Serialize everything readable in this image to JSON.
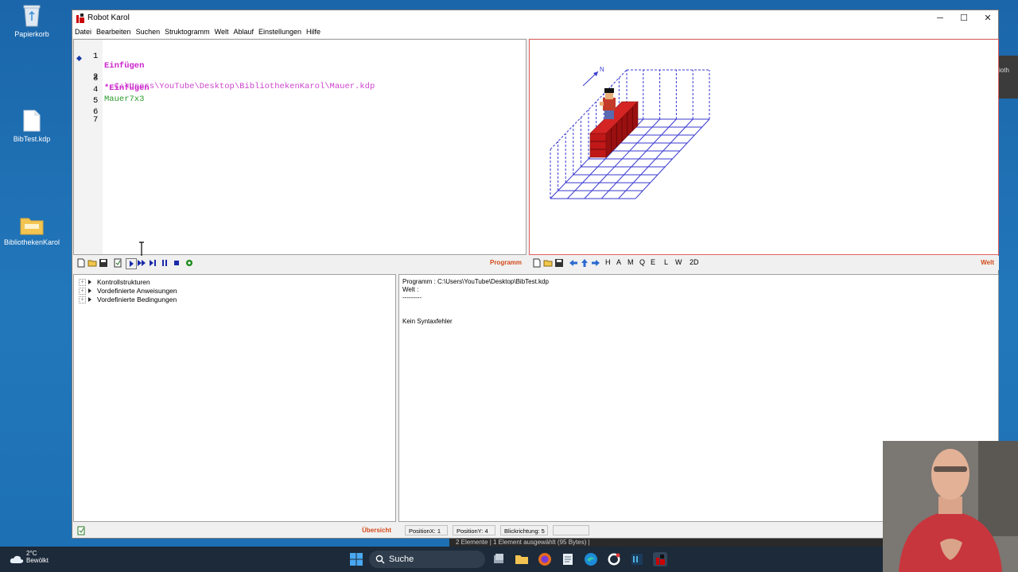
{
  "desktop": {
    "icons": [
      {
        "label": "Papierkorb"
      },
      {
        "label": "BibTest.kdp"
      },
      {
        "label": "BibliothekenKarol"
      }
    ],
    "right_edge_text": "ioth"
  },
  "window": {
    "title": "Robot Karol",
    "controls": {
      "minimize": "─",
      "maximize": "☐",
      "close": "✕"
    }
  },
  "menu": [
    "Datei",
    "Bearbeiten",
    "Suchen",
    "Struktogramm",
    "Welt",
    "Ablauf",
    "Einstellungen",
    "Hilfe"
  ],
  "editor": {
    "lines": [
      {
        "num": "1",
        "text": "Einfügen",
        "style": "kw"
      },
      {
        "num": "2",
        "text": "  C:\\Users\\YouTube\\Desktop\\BibliothekenKarol\\Mauer.kdp",
        "style": "path"
      },
      {
        "num": "3",
        "text": "*Einfügen",
        "style": "kw"
      },
      {
        "num": "4",
        "text": "Mauer7x3",
        "style": "ident"
      },
      {
        "num": "5",
        "text": "",
        "style": ""
      },
      {
        "num": "6",
        "text": "",
        "style": ""
      },
      {
        "num": "7",
        "text": "",
        "style": ""
      }
    ],
    "toolbar_title": "Programm"
  },
  "world": {
    "compass": "N",
    "toolbar_letters": [
      "H",
      "A",
      "M",
      "Q",
      "E",
      "L",
      "W",
      "2D"
    ],
    "toolbar_title": "Welt"
  },
  "tree": {
    "items": [
      "Kontrollstrukturen",
      "Vordefinierte Anweisungen",
      "Vordefinierte Bedingungen"
    ],
    "footer_title": "Übersicht"
  },
  "output": {
    "lines": [
      "Programm : C:\\Users\\YouTube\\Desktop\\BibTest.kdp",
      "Welt :",
      "---------",
      "",
      "Kein Syntaxfehler"
    ]
  },
  "status": {
    "position_x": "PositionX: 1",
    "position_y": "PositionY: 4",
    "blickrichtung": "Blickrichtung: 5",
    "empty": ""
  },
  "explorer_status": "2 Elemente  |  1 Element ausgewählt (95 Bytes)  |",
  "taskbar": {
    "temperature": "2°C",
    "weather": "Bewölkt",
    "search_label": "Suche"
  },
  "colors": {
    "keyword": "#cc22cc",
    "identifier": "#2a9a2a",
    "toolbar_title": "#d34a1a",
    "world_grid": "#3a3ad0",
    "brick": "#c01818"
  }
}
